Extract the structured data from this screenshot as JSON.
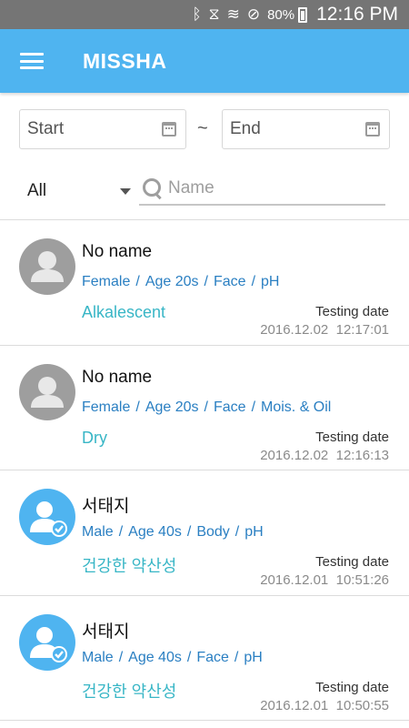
{
  "status_bar": {
    "icons": [
      "bluetooth-icon",
      "vibrate-icon",
      "wifi-icon",
      "do-not-disturb-icon"
    ],
    "battery": "80%",
    "time": "12:16 PM"
  },
  "app_bar": {
    "title": "MISSHA"
  },
  "date_filter": {
    "start_placeholder": "Start",
    "separator": "~",
    "end_placeholder": "End"
  },
  "category_filter": {
    "selected": "All"
  },
  "search": {
    "placeholder": "Name",
    "value": ""
  },
  "colors": {
    "app_bar": "#4fb4f0",
    "tags": "#2a7fc2",
    "result": "#38b6c6",
    "avatar_default": "#9e9e9e",
    "avatar_verified": "#4fb4f0"
  },
  "records": [
    {
      "name": "No name",
      "avatar": "default",
      "gender": "Female",
      "age": "Age 20s",
      "area": "Face",
      "test": "pH",
      "result": "Alkalescent",
      "date_label": "Testing date",
      "date": "2016.12.02",
      "time": "12:17:01"
    },
    {
      "name": "No name",
      "avatar": "default",
      "gender": "Female",
      "age": "Age 20s",
      "area": "Face",
      "test": "Mois. & Oil",
      "result": "Dry",
      "date_label": "Testing date",
      "date": "2016.12.02",
      "time": "12:16:13"
    },
    {
      "name": "서태지",
      "avatar": "verified",
      "gender": "Male",
      "age": "Age 40s",
      "area": "Body",
      "test": "pH",
      "result": "건강한 약산성",
      "date_label": "Testing date",
      "date": "2016.12.01",
      "time": "10:51:26"
    },
    {
      "name": "서태지",
      "avatar": "verified",
      "gender": "Male",
      "age": "Age 40s",
      "area": "Face",
      "test": "pH",
      "result": "건강한 약산성",
      "date_label": "Testing date",
      "date": "2016.12.01",
      "time": "10:50:55"
    }
  ]
}
